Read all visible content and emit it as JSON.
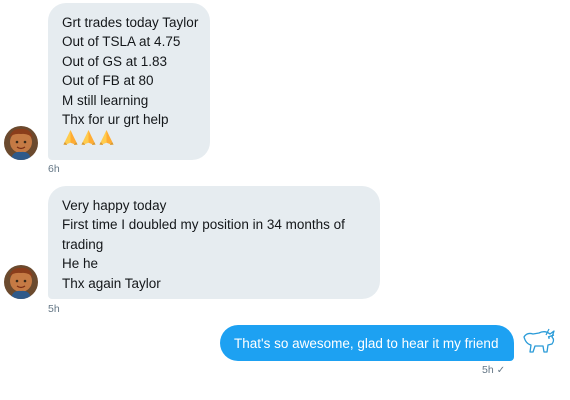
{
  "messages": [
    {
      "direction": "incoming",
      "lines": [
        "Grt trades today Taylor",
        "Out of TSLA at 4.75",
        "Out of GS at 1.83",
        "Out of FB at 80",
        "M still learning",
        "Thx for ur grt help"
      ],
      "emoji": [
        "folded-hands",
        "folded-hands",
        "folded-hands"
      ],
      "time": "6h"
    },
    {
      "direction": "incoming",
      "lines": [
        "Very happy today",
        "First time I doubled my position in 34 months of",
        "trading",
        "He he",
        "Thx again Taylor"
      ],
      "time": "5h"
    },
    {
      "direction": "outgoing",
      "text": "That's so awesome, glad to hear it my friend",
      "time": "5h",
      "status": "✓"
    }
  ],
  "colors": {
    "incoming_bubble": "#e6ecf0",
    "outgoing_bubble": "#1da1f2",
    "meta_text": "#657786"
  },
  "icons": {
    "sender_avatar": "avatar-photo",
    "own_avatar": "bull-logo-icon",
    "read_status": "check-icon"
  }
}
